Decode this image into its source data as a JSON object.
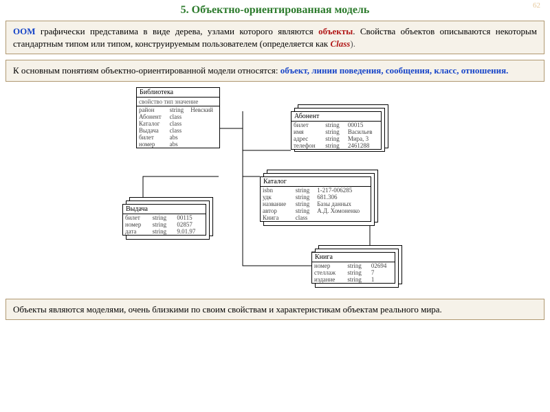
{
  "pageNumber": "62",
  "title": "5. Объектно-ориентированная модель",
  "box1": {
    "oom": "ООМ",
    "t1": " графически представима в виде дерева, узлами которого являются ",
    "obj": "объекты",
    "t2": ". Свойства объектов описываются некоторым стандартным типом или типом, конструируемым пользователем (определяется как ",
    "cls": "Class",
    "t3": ")."
  },
  "box2": {
    "pre": "К основным понятиям объектно-ориентированной модели относятся: ",
    "concepts": "объект, линии поведения, сообщения, класс, отношения."
  },
  "box3": "Объекты являются моделями, очень близкими по своим свойствам и характеристикам объектам реального мира.",
  "diagram": {
    "library": {
      "title": "Библиотека",
      "cols": "свойство  тип  значение",
      "rows": [
        [
          "район",
          "string",
          "Невский"
        ],
        [
          "Абонент",
          "class",
          ""
        ],
        [
          "Каталог",
          "class",
          ""
        ],
        [
          "Выдача",
          "class",
          ""
        ],
        [
          "билет",
          "abs",
          ""
        ],
        [
          "номер",
          "abs",
          ""
        ]
      ]
    },
    "issue": {
      "title": "Выдача",
      "rows": [
        [
          "билет",
          "string",
          "00115"
        ],
        [
          "номер",
          "string",
          "02857"
        ],
        [
          "дата",
          "string",
          "9.01.97"
        ]
      ]
    },
    "abonent": {
      "title": "Абонент",
      "rows": [
        [
          "билет",
          "string",
          "00015"
        ],
        [
          "имя",
          "string",
          "Васильев"
        ],
        [
          "адрес",
          "string",
          "Мира, 3"
        ],
        [
          "телефон",
          "string",
          "2461288"
        ]
      ]
    },
    "catalog": {
      "title": "Каталог",
      "rows": [
        [
          "isbn",
          "string",
          "1-217-006285"
        ],
        [
          "удк",
          "string",
          "681.306"
        ],
        [
          "название",
          "string",
          "Базы данных"
        ],
        [
          "автор",
          "string",
          "А.Д. Хомоненко"
        ],
        [
          "Книга",
          "class",
          ""
        ]
      ]
    },
    "book": {
      "title": "Книга",
      "rows": [
        [
          "номер",
          "string",
          "02694"
        ],
        [
          "стеллаж",
          "string",
          "7"
        ],
        [
          "издание",
          "string",
          "1"
        ]
      ]
    }
  }
}
